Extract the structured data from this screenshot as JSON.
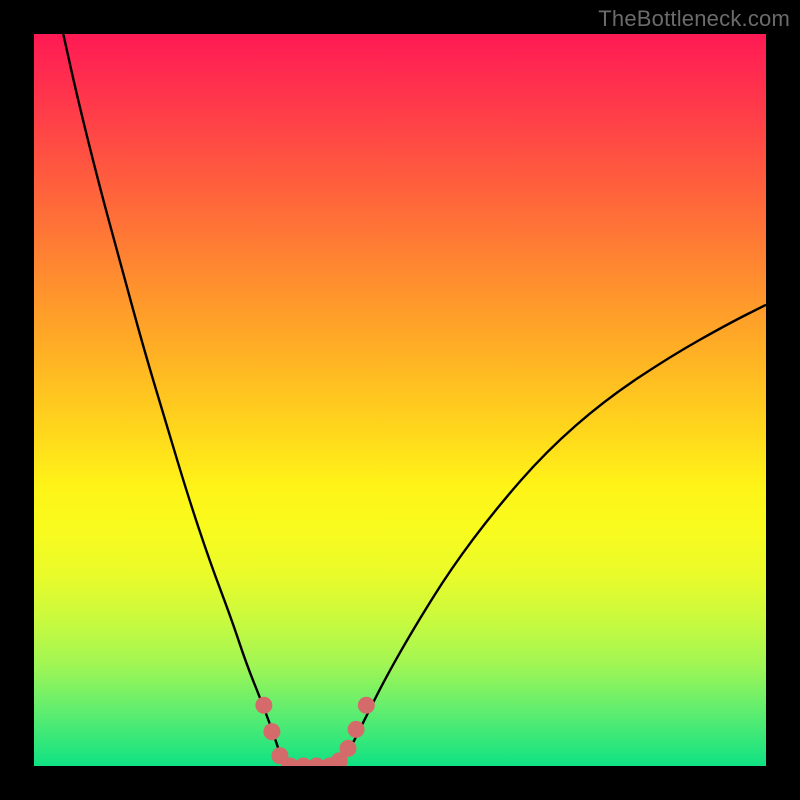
{
  "watermark": {
    "text": "TheBottleneck.com"
  },
  "chart_data": {
    "type": "line",
    "title": "",
    "xlabel": "",
    "ylabel": "",
    "xlim": [
      0,
      1
    ],
    "ylim": [
      0,
      1
    ],
    "grid": false,
    "legend": false,
    "series": [
      {
        "name": "curve-left",
        "stroke": "#000000",
        "x": [
          0.04,
          0.06,
          0.09,
          0.12,
          0.15,
          0.18,
          0.21,
          0.24,
          0.27,
          0.29,
          0.31,
          0.325,
          0.335,
          0.342
        ],
        "y": [
          1.0,
          0.91,
          0.79,
          0.68,
          0.57,
          0.47,
          0.37,
          0.28,
          0.2,
          0.14,
          0.09,
          0.05,
          0.02,
          0.0
        ]
      },
      {
        "name": "valley-floor",
        "stroke": "#000000",
        "x": [
          0.342,
          0.36,
          0.38,
          0.4,
          0.415
        ],
        "y": [
          0.0,
          0.0,
          0.0,
          0.0,
          0.0
        ]
      },
      {
        "name": "curve-right",
        "stroke": "#000000",
        "x": [
          0.415,
          0.43,
          0.45,
          0.48,
          0.52,
          0.57,
          0.63,
          0.7,
          0.78,
          0.87,
          0.95,
          1.0
        ],
        "y": [
          0.0,
          0.02,
          0.06,
          0.12,
          0.19,
          0.27,
          0.35,
          0.43,
          0.5,
          0.56,
          0.605,
          0.63
        ]
      }
    ],
    "markers": [
      {
        "name": "marker-left-top",
        "x": 0.314,
        "y": 0.083,
        "r": 8.5,
        "fill": "#d46a6a"
      },
      {
        "name": "marker-left-mid",
        "x": 0.325,
        "y": 0.047,
        "r": 8.5,
        "fill": "#d46a6a"
      },
      {
        "name": "marker-left-low",
        "x": 0.336,
        "y": 0.014,
        "r": 8.5,
        "fill": "#d46a6a"
      },
      {
        "name": "marker-floor-1",
        "x": 0.35,
        "y": 0.0,
        "r": 8.5,
        "fill": "#d46a6a"
      },
      {
        "name": "marker-floor-2",
        "x": 0.368,
        "y": 0.0,
        "r": 8.5,
        "fill": "#d46a6a"
      },
      {
        "name": "marker-floor-3",
        "x": 0.386,
        "y": 0.0,
        "r": 8.5,
        "fill": "#d46a6a"
      },
      {
        "name": "marker-floor-4",
        "x": 0.404,
        "y": 0.0,
        "r": 8.5,
        "fill": "#d46a6a"
      },
      {
        "name": "marker-right-low",
        "x": 0.417,
        "y": 0.007,
        "r": 8.5,
        "fill": "#d46a6a"
      },
      {
        "name": "marker-right-mid",
        "x": 0.429,
        "y": 0.024,
        "r": 8.5,
        "fill": "#d46a6a"
      },
      {
        "name": "marker-right-mid2",
        "x": 0.44,
        "y": 0.05,
        "r": 8.5,
        "fill": "#d46a6a"
      },
      {
        "name": "marker-right-top",
        "x": 0.454,
        "y": 0.083,
        "r": 8.5,
        "fill": "#d46a6a"
      }
    ]
  }
}
